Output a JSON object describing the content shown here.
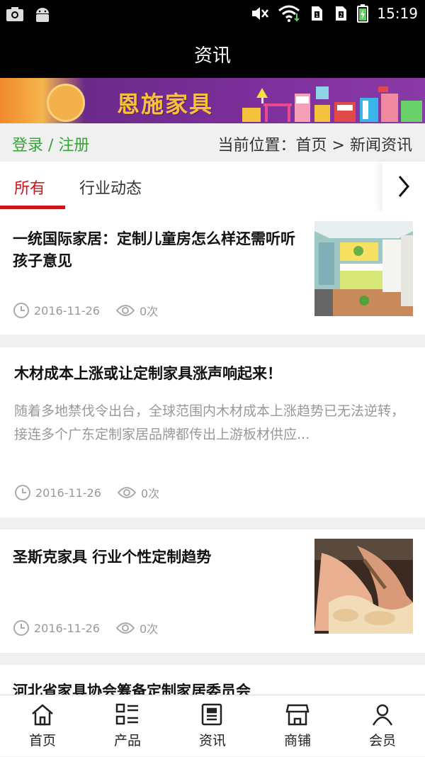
{
  "status_bar": {
    "time": "15:19",
    "icons": [
      "camera-icon",
      "android-icon",
      "mute-icon",
      "wifi-icon",
      "sim1-icon",
      "sim2-icon",
      "battery-icon"
    ]
  },
  "header": {
    "title": "资讯"
  },
  "banner": {
    "brand": "恩施家具"
  },
  "location_bar": {
    "login_register": "登录 / 注册",
    "location_label": "当前位置：",
    "crumb_home": "首页",
    "separator": ">",
    "crumb_current": "新闻资讯"
  },
  "tabs": {
    "items": [
      {
        "label": "所有",
        "active": true
      },
      {
        "label": "行业动态",
        "active": false
      }
    ],
    "more_icon": "chevron-right-icon"
  },
  "articles": [
    {
      "title": "一统国际家居：定制儿童房怎么样还需听听孩子意见",
      "date": "2016-11-26",
      "views": "0次",
      "thumb": "kids-room"
    },
    {
      "title": "木材成本上涨或让定制家具涨声响起来！",
      "summary": "随着多地禁伐令出台，全球范围内木材成本上涨趋势已无法逆转，接连多个广东定制家居品牌都传出上游板材供应...",
      "date": "2016-11-26",
      "views": "0次"
    },
    {
      "title": "圣斯克家具 行业个性定制趋势",
      "date": "2016-11-26",
      "views": "0次",
      "thumb": "wood-carving"
    },
    {
      "title": "河北省家具协会筹备定制家居委员会"
    }
  ],
  "bottom_nav": [
    {
      "label": "首页",
      "icon": "home-icon"
    },
    {
      "label": "产品",
      "icon": "grid-list-icon"
    },
    {
      "label": "资讯",
      "icon": "news-icon"
    },
    {
      "label": "商铺",
      "icon": "shop-icon"
    },
    {
      "label": "会员",
      "icon": "user-icon"
    }
  ],
  "colors": {
    "accent_red": "#c8161d",
    "login_green": "#3aa23a",
    "header_bg": "#000000"
  }
}
